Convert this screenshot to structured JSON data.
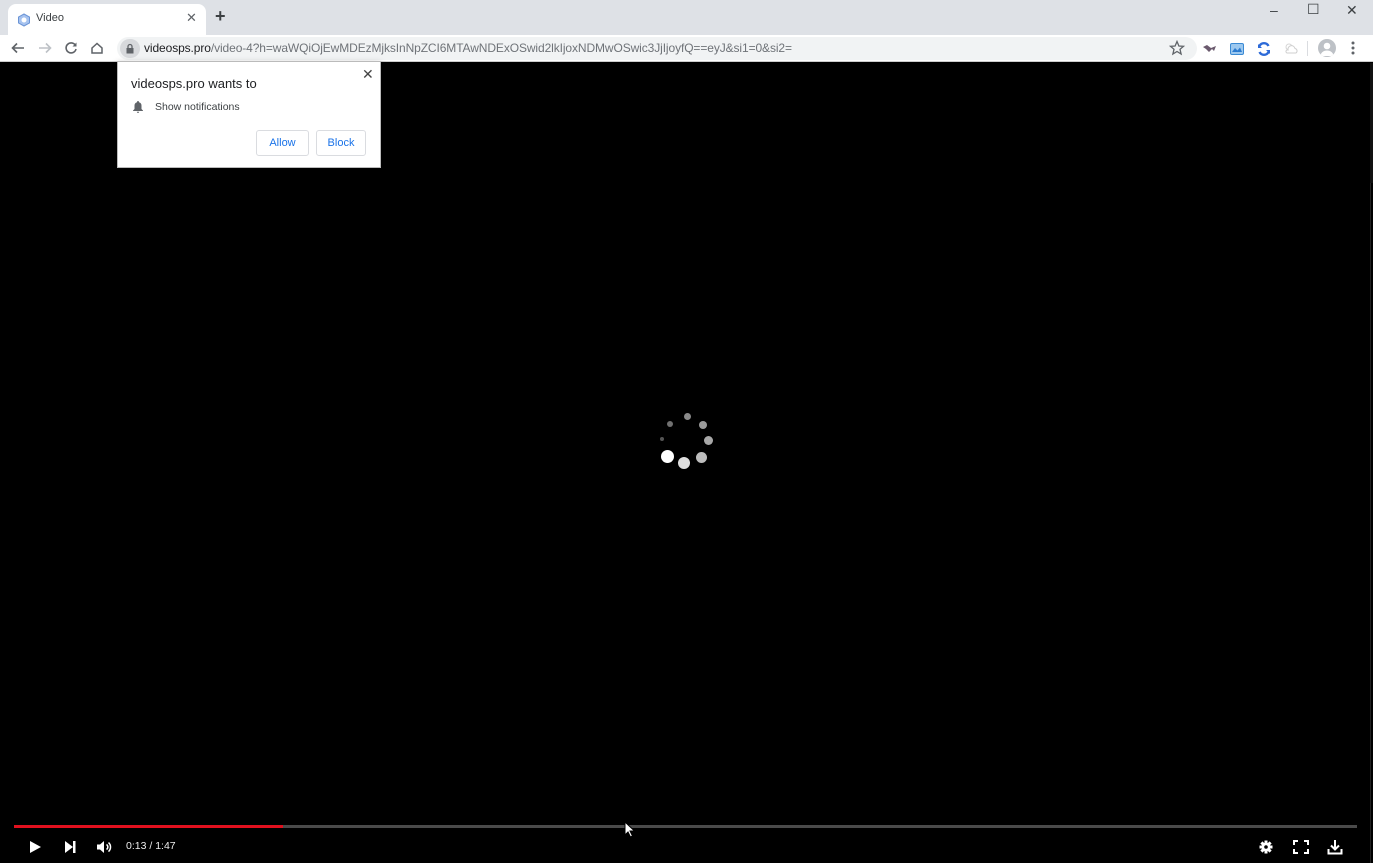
{
  "browser": {
    "tab": {
      "title": "Video",
      "favicon": "video-favicon-icon"
    },
    "new_tab_label": "+",
    "window_controls": {
      "minimize": "–",
      "maximize": "☐",
      "close": "✕"
    },
    "address_bar": {
      "domain": "videosps.pro",
      "path": "/video-4?h=waWQiOjEwMDEzMjksInNpZCI6MTAwNDExOSwid2lkIjoxNDMwOSwic3JjIjoyfQ==eyJ&si1=0&si2=",
      "secure_icon": "lock-icon"
    },
    "extensions": [
      "extension-dark-icon",
      "extension-photo-icon",
      "extension-sync-icon",
      "extension-weather-icon"
    ]
  },
  "permission_prompt": {
    "title": "videosps.pro wants to",
    "permission": "Show notifications",
    "allow_label": "Allow",
    "block_label": "Block",
    "close_label": "✕"
  },
  "player": {
    "state": "loading",
    "current_time": "0:13",
    "duration": "1:47",
    "time_display": "0:13 / 1:47",
    "progress_fraction": 0.2,
    "colors": {
      "progress": "#e0101e",
      "track": "#4a4a4a",
      "background": "#000000"
    }
  }
}
